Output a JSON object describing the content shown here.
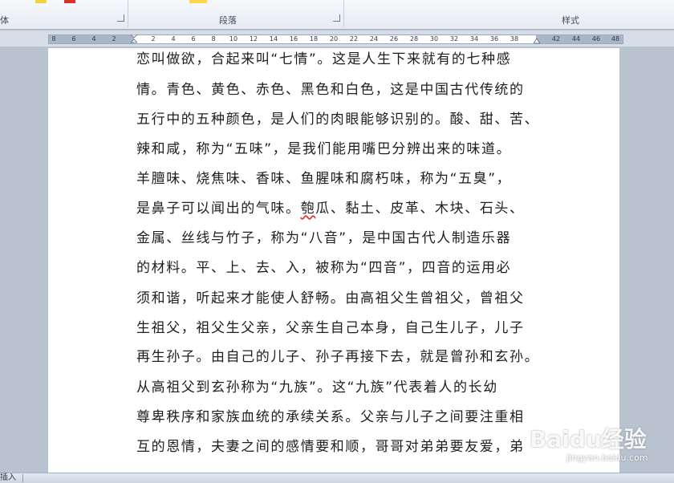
{
  "ribbon": {
    "groups": [
      {
        "label": "体"
      },
      {
        "label": "段落"
      },
      {
        "label": "样式"
      }
    ],
    "accent_colors": [
      "#f3d23a",
      "#d8302a",
      "#ffd54a"
    ]
  },
  "ruler": {
    "ticks": [
      "8",
      "6",
      "4",
      "2",
      "2",
      "4",
      "6",
      "8",
      "10",
      "12",
      "14",
      "16",
      "18",
      "20",
      "22",
      "24",
      "26",
      "28",
      "30",
      "32",
      "34",
      "36",
      "38",
      "42",
      "44",
      "46",
      "48"
    ]
  },
  "document": {
    "lines": [
      "恋叫做欲，合起来叫“七情”。这是人生下来就有的七种感",
      "情。青色、黄色、赤色、黑色和白色，这是中国古代传统的",
      "五行中的五种颜色，是人们的肉眼能够识别的。酸、甜、苦、",
      "辣和咸，称为“五味”，是我们能用嘴巴分辨出来的味道。",
      "羊膻味、烧焦味、香味、鱼腥味和腐朽味，称为“五臭”，",
      "是鼻子可以闻出的气味。",
      "金属、丝线与竹子，称为“八音”，是中国古代人制造乐器",
      "的材料。平、上、去、入，被称为“四音”，四音的运用必",
      "须和谐，听起来才能使人舒畅。由高祖父生曾祖父，曾祖父",
      "生祖父，祖父生父亲，父亲生自己本身，自己生儿子，儿子",
      "再生孙子。由自己的儿子、孙子再接下去，就是曾孙和玄孙。",
      "从高祖父到玄孙称为“九族”。这“九族”代表着人的长幼",
      "尊卑秩序和家族血统的承续关系。父亲与儿子之间要注重相",
      "互的恩情，夫妻之间的感情要和顺，哥哥对弟弟要友爱，弟"
    ],
    "line6_squiggle": "匏",
    "line6_rest": "瓜、黏土、皮革、木块、石头、"
  },
  "statusbar": {
    "mode": "插入"
  },
  "watermark": {
    "logo": "Baidu经验",
    "url": "jingyan.baidu.com"
  }
}
